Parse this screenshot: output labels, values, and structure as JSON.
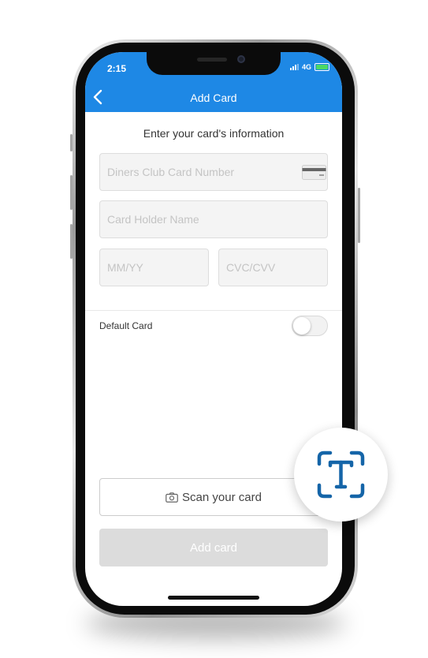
{
  "status_bar": {
    "time": "2:15",
    "network": "4G"
  },
  "header": {
    "title": "Add Card",
    "back_icon": "chevron-left-icon"
  },
  "form": {
    "subtitle": "Enter your card's information",
    "card_number": {
      "value": "",
      "placeholder": "Diners Club Card Number",
      "icon": "card-icon"
    },
    "holder_name": {
      "value": "",
      "placeholder": "Card Holder Name"
    },
    "expiry": {
      "value": "",
      "placeholder": "MM/YY"
    },
    "cvc": {
      "value": "",
      "placeholder": "CVC/CVV"
    }
  },
  "default_card": {
    "label": "Default Card",
    "enabled": false
  },
  "buttons": {
    "scan_label": "Scan your card",
    "scan_icon": "camera-icon",
    "add_label": "Add card"
  },
  "ocr_badge": {
    "icon": "text-recognition-icon"
  },
  "colors": {
    "header_bg": "#1e88e5",
    "field_bg": "#f4f4f4",
    "placeholder": "#c4c4c4",
    "disabled_button": "#dcdcdc",
    "battery": "#4cd964",
    "ocr_icon": "#1565a8"
  }
}
